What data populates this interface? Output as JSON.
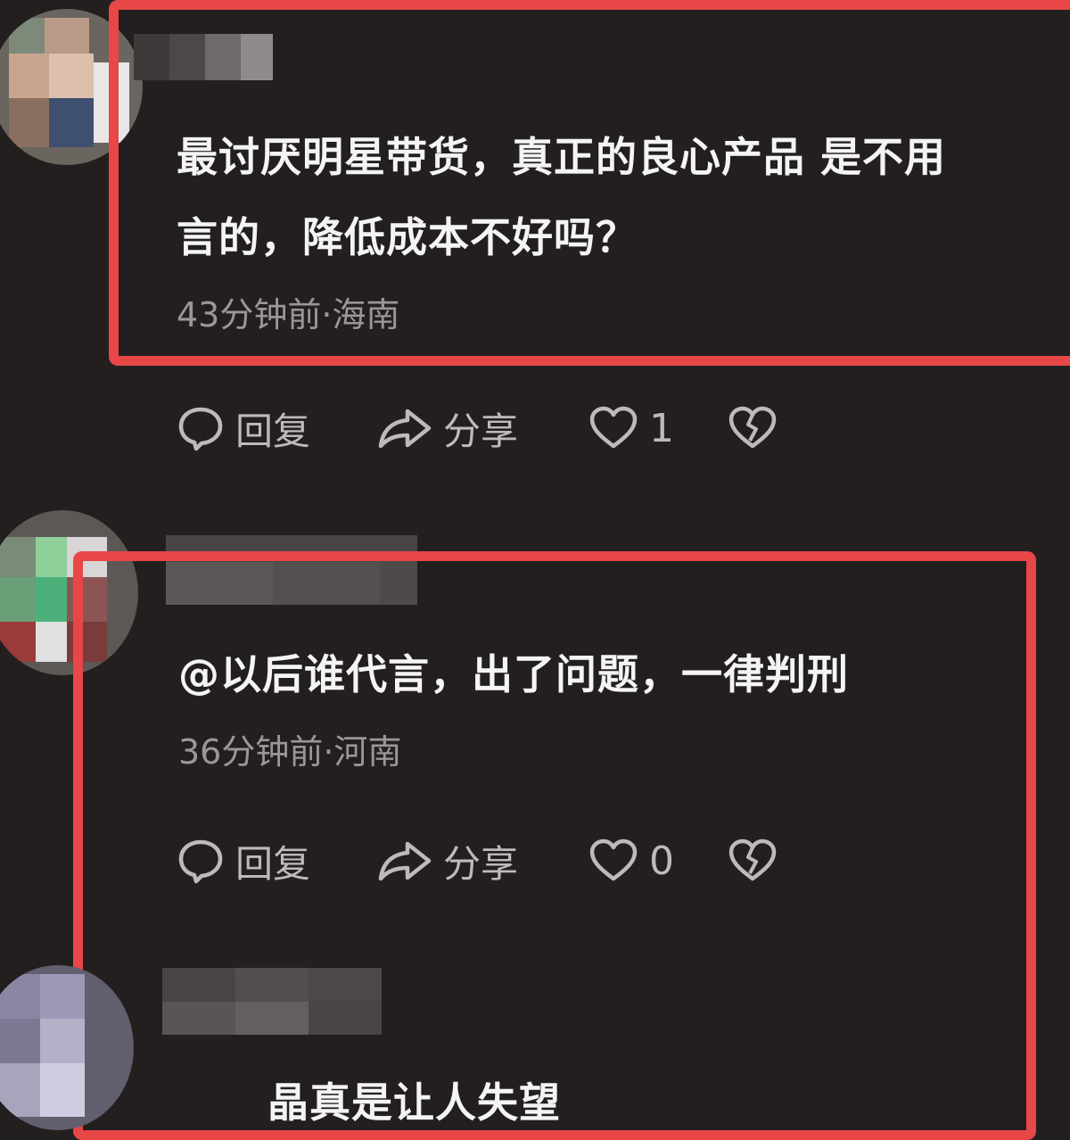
{
  "comments": [
    {
      "text_line1": "最讨厌明星带货，真正的良心产品 是不用",
      "text_line2": "言的，降低成本不好吗？",
      "meta": "43分钟前·海南",
      "actions": {
        "reply": "回复",
        "share": "分享",
        "likes": "1"
      }
    },
    {
      "text_line1": "@以后谁代言，出了问题，一律判刑",
      "meta": "36分钟前·河南",
      "actions": {
        "reply": "回复",
        "share": "分享",
        "likes": "0"
      }
    },
    {
      "text_line1": "晶真是让人失望"
    }
  ],
  "icons": {
    "reply": "speech-bubble-icon",
    "share": "share-arrow-icon",
    "like": "heart-icon",
    "dislike": "broken-heart-icon"
  },
  "colors": {
    "background": "#241f1f",
    "highlight": "#e74747",
    "text": "#f4f4f4",
    "meta": "#9b9797"
  }
}
